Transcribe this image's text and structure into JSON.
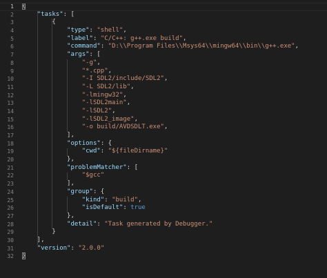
{
  "editor": {
    "line_numbers": [
      "1",
      "2",
      "3",
      "4",
      "5",
      "6",
      "7",
      "8",
      "9",
      "10",
      "11",
      "12",
      "13",
      "14",
      "15",
      "16",
      "17",
      "18",
      "19",
      "20",
      "21",
      "22",
      "23",
      "24",
      "25",
      "26",
      "27",
      "28",
      "29",
      "30",
      "31",
      "32"
    ],
    "lines": [
      [
        {
          "t": "{",
          "c": "p",
          "hl": true
        }
      ],
      [
        {
          "t": "    ",
          "c": "p"
        },
        {
          "t": "\"tasks\"",
          "c": "k"
        },
        {
          "t": ": [",
          "c": "p"
        }
      ],
      [
        {
          "t": "        {",
          "c": "p"
        }
      ],
      [
        {
          "t": "            ",
          "c": "p"
        },
        {
          "t": "\"type\"",
          "c": "k"
        },
        {
          "t": ": ",
          "c": "p"
        },
        {
          "t": "\"shell\"",
          "c": "s"
        },
        {
          "t": ",",
          "c": "p"
        }
      ],
      [
        {
          "t": "            ",
          "c": "p"
        },
        {
          "t": "\"label\"",
          "c": "k"
        },
        {
          "t": ": ",
          "c": "p"
        },
        {
          "t": "\"C/C++: g++.exe build\"",
          "c": "s"
        },
        {
          "t": ",",
          "c": "p"
        }
      ],
      [
        {
          "t": "            ",
          "c": "p"
        },
        {
          "t": "\"command\"",
          "c": "k"
        },
        {
          "t": ": ",
          "c": "p"
        },
        {
          "t": "\"D:\\\\Program Files\\\\Msys64\\\\mingw64\\\\bin\\\\g++.exe\"",
          "c": "s"
        },
        {
          "t": ",",
          "c": "p"
        }
      ],
      [
        {
          "t": "            ",
          "c": "p"
        },
        {
          "t": "\"args\"",
          "c": "k"
        },
        {
          "t": ": [",
          "c": "p"
        }
      ],
      [
        {
          "t": "                ",
          "c": "p"
        },
        {
          "t": "\"-g\"",
          "c": "s"
        },
        {
          "t": ",",
          "c": "p"
        }
      ],
      [
        {
          "t": "                ",
          "c": "p"
        },
        {
          "t": "\"*.cpp\"",
          "c": "s"
        },
        {
          "t": ",",
          "c": "p"
        }
      ],
      [
        {
          "t": "                ",
          "c": "p"
        },
        {
          "t": "\"-I SDL2/include/SDL2\"",
          "c": "s"
        },
        {
          "t": ",",
          "c": "p"
        }
      ],
      [
        {
          "t": "                ",
          "c": "p"
        },
        {
          "t": "\"-L SDL2/lib\"",
          "c": "s"
        },
        {
          "t": ",",
          "c": "p"
        }
      ],
      [
        {
          "t": "                ",
          "c": "p"
        },
        {
          "t": "\"-lmingw32\"",
          "c": "s"
        },
        {
          "t": ",",
          "c": "p"
        }
      ],
      [
        {
          "t": "                ",
          "c": "p"
        },
        {
          "t": "\"-lSDL2main\"",
          "c": "s"
        },
        {
          "t": ",",
          "c": "p"
        }
      ],
      [
        {
          "t": "                ",
          "c": "p"
        },
        {
          "t": "\"-lSDL2\"",
          "c": "s"
        },
        {
          "t": ",",
          "c": "p"
        }
      ],
      [
        {
          "t": "                ",
          "c": "p"
        },
        {
          "t": "\"-lSDL2_image\"",
          "c": "s"
        },
        {
          "t": ",",
          "c": "p"
        }
      ],
      [
        {
          "t": "                ",
          "c": "p"
        },
        {
          "t": "\"-o build/AVDSDLT.exe\"",
          "c": "s"
        },
        {
          "t": ",",
          "c": "p"
        }
      ],
      [
        {
          "t": "            ],",
          "c": "p"
        }
      ],
      [
        {
          "t": "            ",
          "c": "p"
        },
        {
          "t": "\"options\"",
          "c": "k"
        },
        {
          "t": ": {",
          "c": "p"
        }
      ],
      [
        {
          "t": "                ",
          "c": "p"
        },
        {
          "t": "\"cwd\"",
          "c": "k"
        },
        {
          "t": ": ",
          "c": "p"
        },
        {
          "t": "\"${fileDirname}\"",
          "c": "s"
        }
      ],
      [
        {
          "t": "            },",
          "c": "p"
        }
      ],
      [
        {
          "t": "            ",
          "c": "p"
        },
        {
          "t": "\"problemMatcher\"",
          "c": "k"
        },
        {
          "t": ": [",
          "c": "p"
        }
      ],
      [
        {
          "t": "                ",
          "c": "p"
        },
        {
          "t": "\"$gcc\"",
          "c": "s"
        }
      ],
      [
        {
          "t": "            ],",
          "c": "p"
        }
      ],
      [
        {
          "t": "            ",
          "c": "p"
        },
        {
          "t": "\"group\"",
          "c": "k"
        },
        {
          "t": ": {",
          "c": "p"
        }
      ],
      [
        {
          "t": "                ",
          "c": "p"
        },
        {
          "t": "\"kind\"",
          "c": "k"
        },
        {
          "t": ": ",
          "c": "p"
        },
        {
          "t": "\"build\"",
          "c": "s"
        },
        {
          "t": ",",
          "c": "p"
        }
      ],
      [
        {
          "t": "                ",
          "c": "p"
        },
        {
          "t": "\"isDefault\"",
          "c": "k"
        },
        {
          "t": ": ",
          "c": "p"
        },
        {
          "t": "true",
          "c": "b"
        }
      ],
      [
        {
          "t": "            },",
          "c": "p"
        }
      ],
      [
        {
          "t": "            ",
          "c": "p"
        },
        {
          "t": "\"detail\"",
          "c": "k"
        },
        {
          "t": ": ",
          "c": "p"
        },
        {
          "t": "\"Task generated by Debugger.\"",
          "c": "s"
        }
      ],
      [
        {
          "t": "        }",
          "c": "p"
        }
      ],
      [
        {
          "t": "    ],",
          "c": "p"
        }
      ],
      [
        {
          "t": "    ",
          "c": "p"
        },
        {
          "t": "\"version\"",
          "c": "k"
        },
        {
          "t": ": ",
          "c": "p"
        },
        {
          "t": "\"2.0.0\"",
          "c": "s"
        }
      ],
      [
        {
          "t": "}",
          "c": "p",
          "hl": true
        }
      ]
    ],
    "active_line": 1,
    "colors": {
      "background": "#1e1e1e",
      "key": "#9cdcfe",
      "string": "#ce9178",
      "boolean": "#569cd6",
      "punctuation": "#d4d4d4",
      "line_number": "#858585"
    }
  }
}
